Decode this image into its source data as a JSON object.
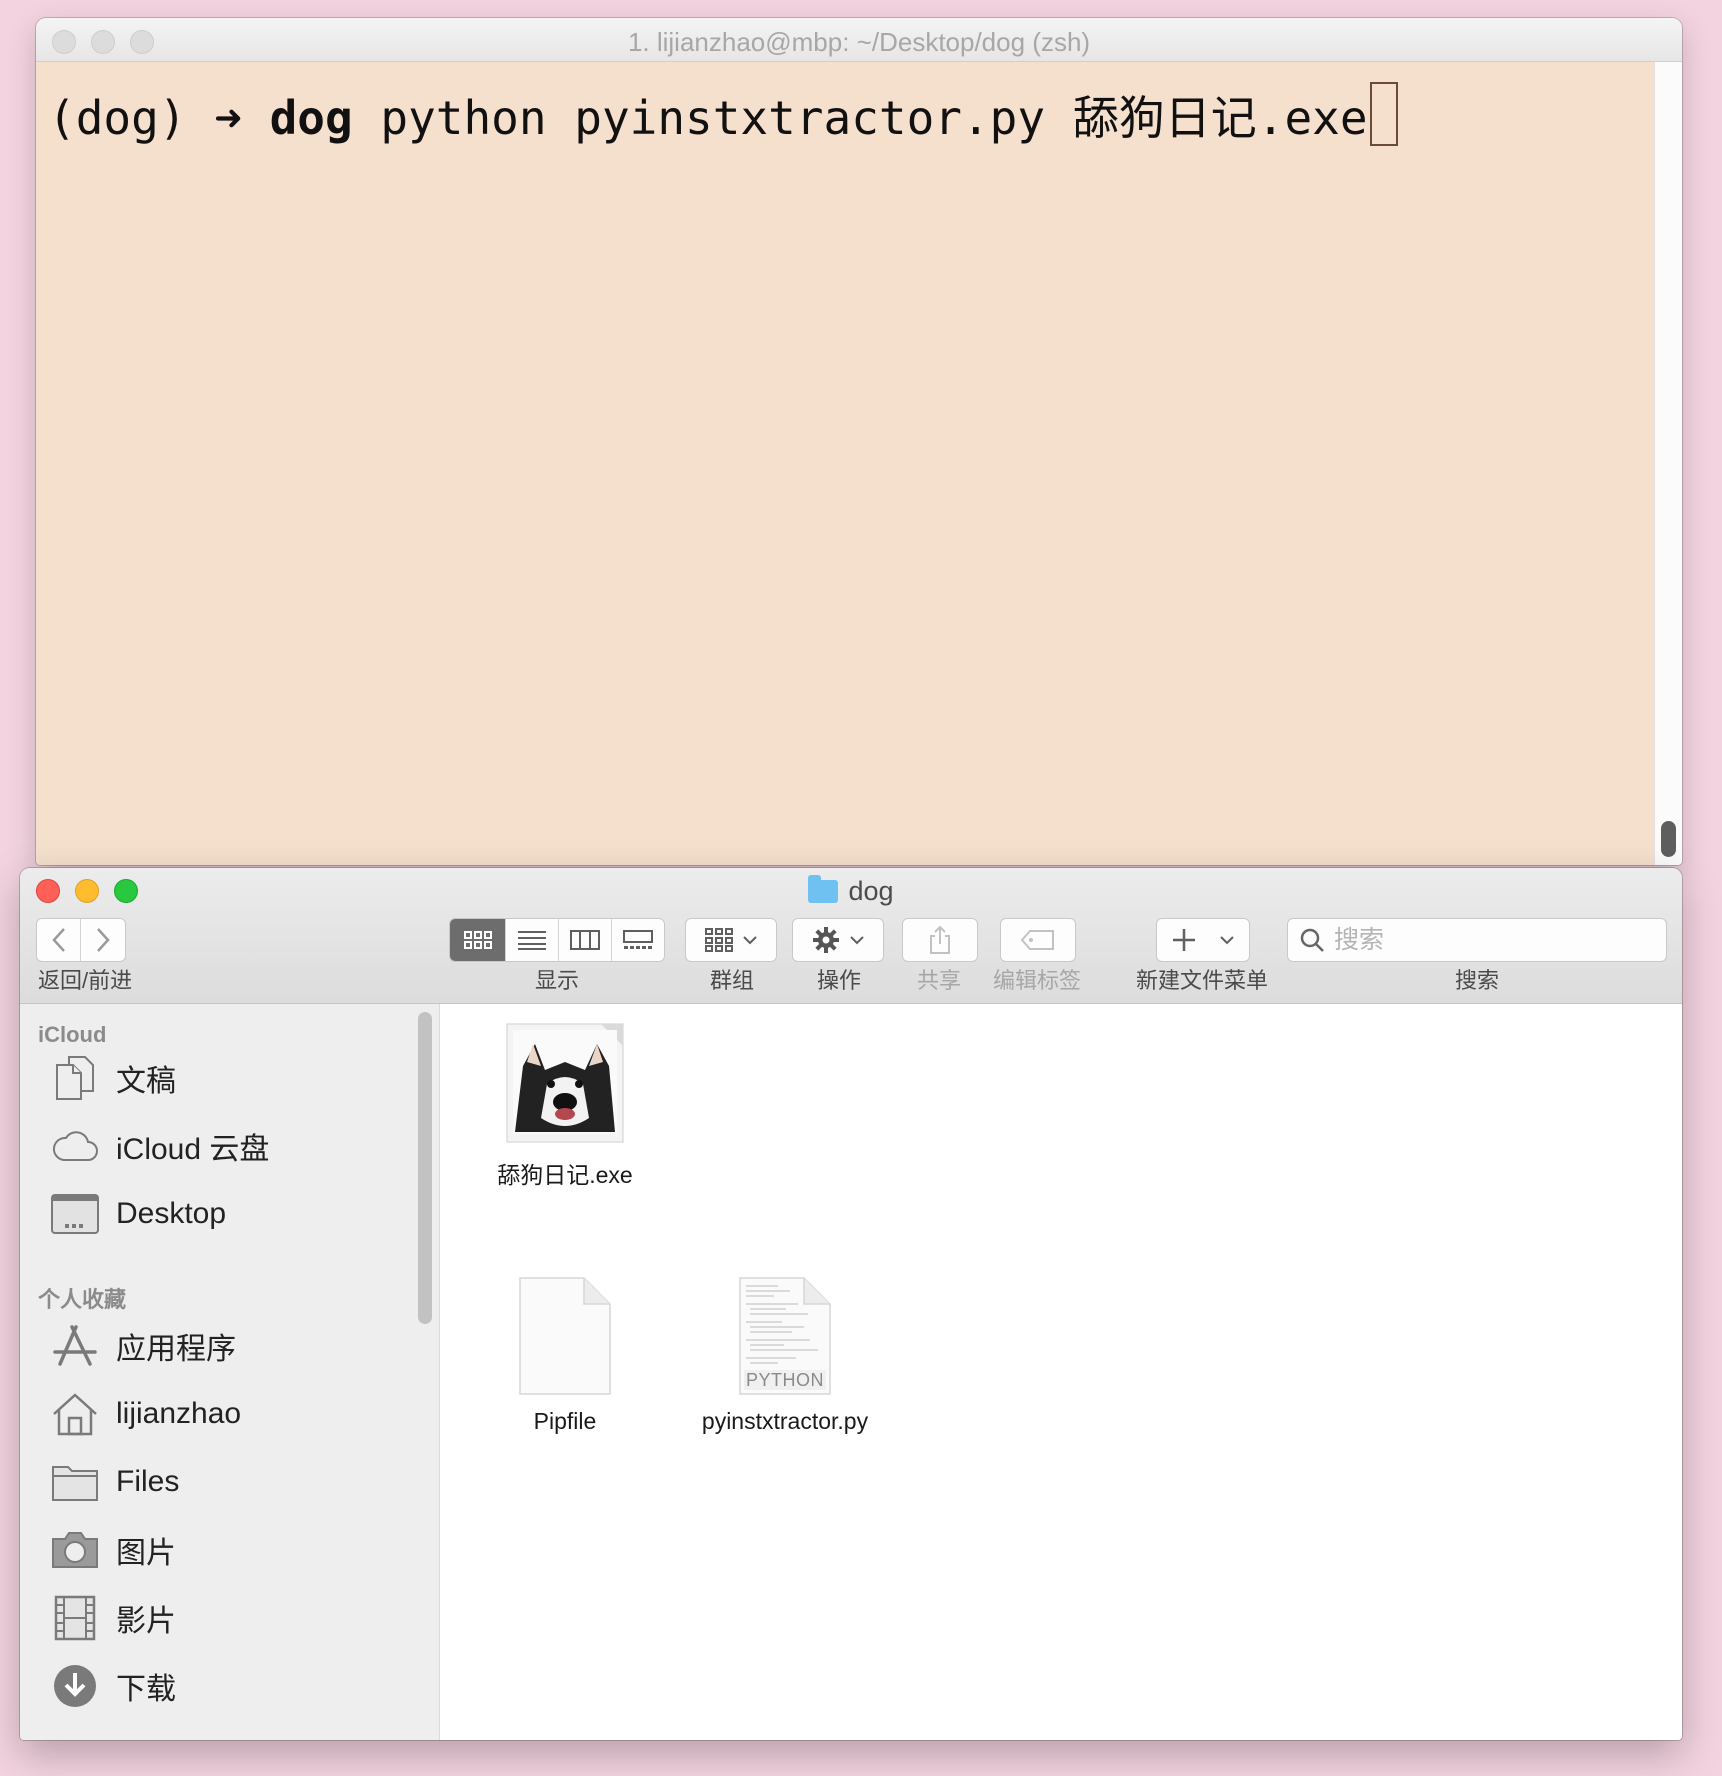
{
  "terminal": {
    "title": "1. lijianzhao@mbp: ~/Desktop/dog (zsh)",
    "prompt_env": "(dog)",
    "prompt_arrow": "➜",
    "prompt_dir": "dog",
    "command": "python pyinstxtractor.py 舔狗日记.exe"
  },
  "finder": {
    "title": "dog",
    "toolbar": {
      "nav_label": "返回/前进",
      "view_label": "显示",
      "group_label": "群组",
      "action_label": "操作",
      "share_label": "共享",
      "tags_label": "编辑标签",
      "new_menu_label": "新建文件菜单",
      "search_label": "搜索",
      "search_placeholder": "搜索"
    },
    "sidebar": {
      "icloud_header": "iCloud",
      "icloud_items": [
        {
          "label": "文稿",
          "icon": "documents-icon"
        },
        {
          "label": "iCloud 云盘",
          "icon": "cloud-icon"
        },
        {
          "label": "Desktop",
          "icon": "desktop-icon"
        }
      ],
      "favorites_header": "个人收藏",
      "favorites_items": [
        {
          "label": "应用程序",
          "icon": "applications-icon"
        },
        {
          "label": "lijianzhao",
          "icon": "home-icon"
        },
        {
          "label": "Files",
          "icon": "folder-icon"
        },
        {
          "label": "图片",
          "icon": "camera-icon"
        },
        {
          "label": "影片",
          "icon": "film-icon"
        },
        {
          "label": "下载",
          "icon": "download-icon"
        }
      ]
    },
    "files": [
      {
        "name": "舔狗日记.exe",
        "icon": "husky-thumbnail-icon"
      },
      {
        "name": "Pipfile",
        "icon": "blank-document-icon"
      },
      {
        "name": "pyinstxtractor.py",
        "icon": "python-document-icon",
        "badge": "PYTHON"
      }
    ]
  }
}
